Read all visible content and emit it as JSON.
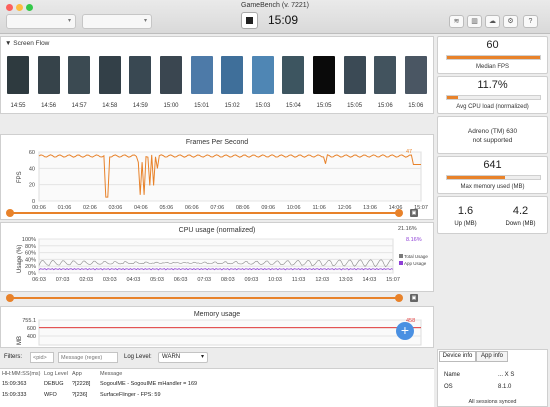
{
  "window": {
    "title": "GameBench (v. 7221)",
    "timer": "15:09",
    "device_select": "",
    "app_select": ""
  },
  "screen_flow": {
    "title": "Screen Flow",
    "thumbnails": [
      {
        "time": "14:55",
        "color": "#2e3a3f"
      },
      {
        "time": "14:56",
        "color": "#36434a"
      },
      {
        "time": "14:57",
        "color": "#3b4a52"
      },
      {
        "time": "14:58",
        "color": "#334048"
      },
      {
        "time": "14:59",
        "color": "#394852"
      },
      {
        "time": "15:00",
        "color": "#3a4650"
      },
      {
        "time": "15:01",
        "color": "#4d7aa8"
      },
      {
        "time": "15:02",
        "color": "#3f6f9a"
      },
      {
        "time": "15:03",
        "color": "#4f86b4"
      },
      {
        "time": "15:04",
        "color": "#3d5560"
      },
      {
        "time": "15:05",
        "color": "#0a0a0a"
      },
      {
        "time": "15:05",
        "color": "#3b4a55"
      },
      {
        "time": "15:06",
        "color": "#42535e"
      },
      {
        "time": "15:06",
        "color": "#4a5663"
      }
    ]
  },
  "fps_chart": {
    "title": "Frames Per Second",
    "ylabel": "FPS",
    "current_value": "47",
    "y_ticks": [
      "60",
      "40",
      "20",
      "0"
    ],
    "x_ticks": [
      "00:06",
      "01:06",
      "02:06",
      "03:06",
      "04:06",
      "05:06",
      "06:06",
      "07:06",
      "08:06",
      "09:06",
      "10:06",
      "11:06",
      "12:06",
      "13:06",
      "14:06",
      "15:07"
    ]
  },
  "cpu_chart": {
    "title": "CPU usage (normalized)",
    "ylabel": "Usage (%)",
    "total_value": "21.16%",
    "app_value": "8.16%",
    "legend_total": "Total Usage",
    "legend_app": "App Usage",
    "y_ticks": [
      "100%",
      "80%",
      "60%",
      "40%",
      "20%",
      "0%"
    ],
    "x_ticks": [
      "06:03",
      "07:03",
      "02:03",
      "03:03",
      "04:03",
      "05:03",
      "06:03",
      "07:03",
      "08:03",
      "09:03",
      "10:03",
      "11:03",
      "12:03",
      "13:03",
      "14:03",
      "15:07"
    ]
  },
  "memory_chart": {
    "title": "Memory usage",
    "ylabel": "MB",
    "current_value": "458",
    "y_ticks": [
      "755.1",
      "600",
      "400"
    ]
  },
  "stats": {
    "median_fps_value": "60",
    "median_fps_label": "Median FPS",
    "median_fps_fill": 1.0,
    "cpu_value": "11.7%",
    "cpu_label": "Avg CPU load (normalized)",
    "cpu_fill": 0.117,
    "gpu_line1": "Adreno (TM) 630",
    "gpu_line2": "not supported",
    "mem_value": "641",
    "mem_label": "Max memory used (MB)",
    "mem_fill": 0.62,
    "up_value": "1.6",
    "up_label": "Up (MB)",
    "down_value": "4.2",
    "down_label": "Down (MB)"
  },
  "filters": {
    "label": "Filters:",
    "pid_placeholder": "<pid>",
    "message_placeholder": "Message (regex)",
    "log_level_label": "Log Level:",
    "log_level_value": "WARN"
  },
  "log": {
    "headers": [
      "HH:MM:SS(ms)",
      "Log Level",
      "App",
      "Message"
    ],
    "rows": [
      {
        "time": "15:09:363",
        "level": "DEBUG",
        "app": "?[2228]",
        "message": "SogouIME - SogouIME mHandler = 169"
      },
      {
        "time": "15:09:333",
        "level": "WFO",
        "app": "?[236]",
        "message": "SurfaceFlinger - FPS: 59"
      }
    ]
  },
  "device_info": {
    "tab_device": "Device info",
    "tab_app": "App info",
    "rows": [
      {
        "key": "Name",
        "value": "... X S"
      },
      {
        "key": "OS",
        "value": "8.1.0"
      }
    ],
    "footer": "All sessions synced"
  }
}
